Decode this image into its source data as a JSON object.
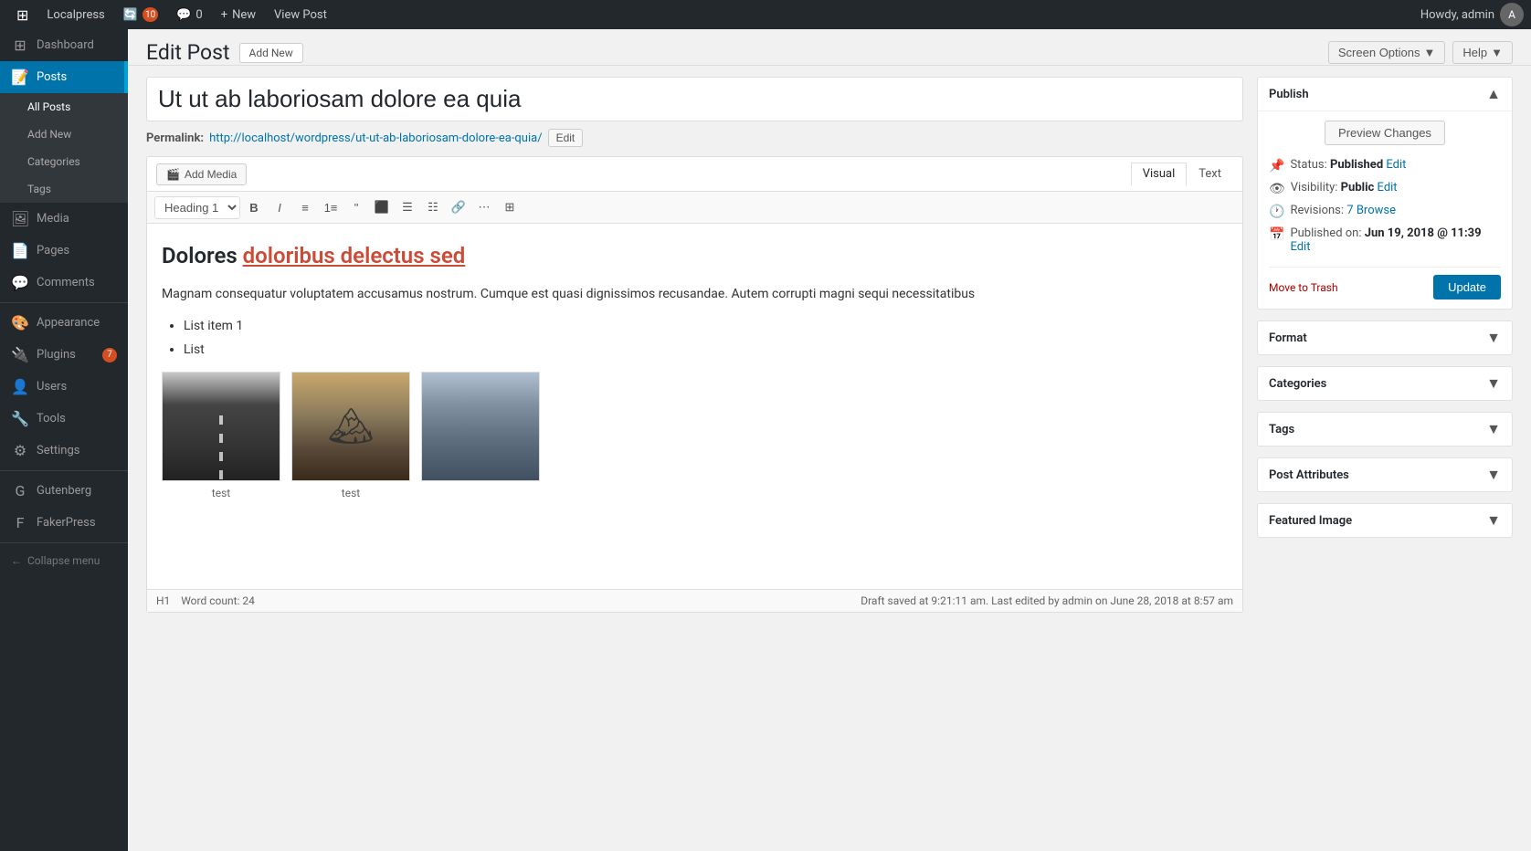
{
  "adminbar": {
    "site_name": "Localpress",
    "updates_count": "10",
    "comments_count": "0",
    "new_label": "New",
    "view_post_label": "View Post",
    "howdy_label": "Howdy, admin"
  },
  "screen_options": {
    "label": "Screen Options",
    "chevron": "▼"
  },
  "help": {
    "label": "Help",
    "chevron": "▼"
  },
  "page": {
    "title": "Edit Post",
    "add_new_label": "Add New"
  },
  "post": {
    "title": "Ut ut ab laboriosam dolore ea quia",
    "permalink_label": "Permalink:",
    "permalink_url": "http://localhost/wordpress/ut-ut-ab-laboriosam-dolore-ea-quia/",
    "permalink_edit_label": "Edit",
    "add_media_label": "Add Media",
    "visual_tab": "Visual",
    "text_tab": "Text",
    "heading_select": "Heading 1",
    "content_heading": "Dolores ",
    "content_heading_underline": "doloribus delectus sed",
    "content_paragraph": "Magnam consequatur voluptatem accusamus nostrum. Cumque est quasi dignissimos recusandae. Autem corrupti magni sequi necessitatibus",
    "list_item1": "List item 1",
    "list_item2": "List",
    "gallery_caption1": "test",
    "gallery_caption2": "test",
    "statusbar_left": "H1",
    "word_count_label": "Word count:",
    "word_count": "24",
    "statusbar_right": "Draft saved at 9:21:11 am. Last edited by admin on June 28, 2018 at 8:57 am"
  },
  "sidebar": {
    "items": [
      {
        "label": "Dashboard",
        "icon": "⊞"
      },
      {
        "label": "Posts",
        "icon": "📝"
      },
      {
        "label": "Media",
        "icon": "🖼"
      },
      {
        "label": "Pages",
        "icon": "📄"
      },
      {
        "label": "Comments",
        "icon": "💬"
      },
      {
        "label": "Appearance",
        "icon": "🎨"
      },
      {
        "label": "Plugins",
        "icon": "🔌",
        "badge": "7"
      },
      {
        "label": "Users",
        "icon": "👤"
      },
      {
        "label": "Tools",
        "icon": "🔧"
      },
      {
        "label": "Settings",
        "icon": "⚙"
      },
      {
        "label": "Gutenberg",
        "icon": "G"
      },
      {
        "label": "FakerPress",
        "icon": "F"
      },
      {
        "label": "Collapse menu",
        "icon": "←"
      }
    ],
    "submenu": {
      "posts": [
        {
          "label": "All Posts",
          "active": true
        },
        {
          "label": "Add New"
        },
        {
          "label": "Categories"
        },
        {
          "label": "Tags"
        }
      ]
    }
  },
  "publish_box": {
    "title": "Publish",
    "preview_btn": "Preview Changes",
    "status_label": "Status:",
    "status_value": "Published",
    "status_edit": "Edit",
    "visibility_label": "Visibility:",
    "visibility_value": "Public",
    "visibility_edit": "Edit",
    "revisions_label": "Revisions:",
    "revisions_value": "7",
    "revisions_browse": "Browse",
    "published_label": "Published on:",
    "published_value": "Jun 19, 2018 @ 11:39",
    "published_edit": "Edit",
    "move_to_trash": "Move to Trash",
    "update_btn": "Update"
  },
  "format_box": {
    "title": "Format"
  },
  "categories_box": {
    "title": "Categories"
  },
  "tags_box": {
    "title": "Tags"
  },
  "post_attributes_box": {
    "title": "Post Attributes"
  },
  "featured_image_box": {
    "title": "Featured Image"
  }
}
